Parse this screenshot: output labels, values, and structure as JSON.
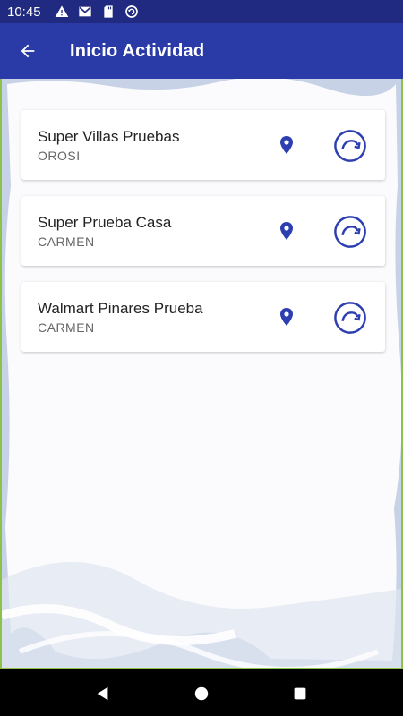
{
  "status_bar": {
    "time": "10:45",
    "icons": [
      "warning-icon",
      "gmail-icon",
      "sd-card-icon",
      "sync-icon"
    ]
  },
  "app_bar": {
    "title": "Inicio Actividad",
    "back_icon": "arrow-back-icon"
  },
  "colors": {
    "primary": "#2a3aa6",
    "status": "#1f2a80",
    "accent_icon": "#2d3fb0",
    "border_accent": "#8bc34a"
  },
  "activities": [
    {
      "name": "Super Villas Pruebas",
      "location": "OROSI"
    },
    {
      "name": "Super Prueba Casa",
      "location": "CARMEN"
    },
    {
      "name": "Walmart Pinares Prueba",
      "location": "CARMEN"
    }
  ],
  "nav_bar": {
    "buttons": [
      "back-triangle-icon",
      "home-circle-icon",
      "recents-square-icon"
    ]
  }
}
